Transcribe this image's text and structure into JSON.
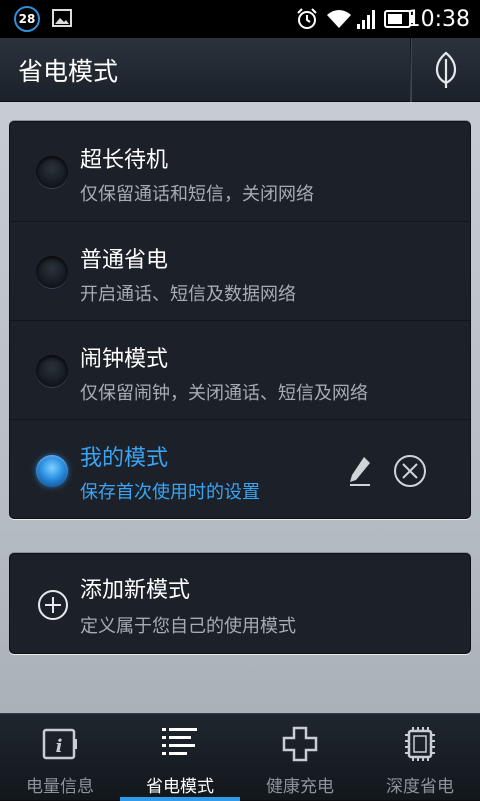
{
  "status_bar": {
    "notification_count": "28",
    "time": "10:38",
    "icons": [
      "gallery-icon",
      "alarm-icon",
      "wifi-icon",
      "signal-icon",
      "battery-icon"
    ]
  },
  "header": {
    "title": "省电模式",
    "action_icon": "leaf-icon"
  },
  "modes": [
    {
      "title": "超长待机",
      "desc": "仅保留通话和短信，关闭网络",
      "selected": false
    },
    {
      "title": "普通省电",
      "desc": "开启通话、短信及数据网络",
      "selected": false
    },
    {
      "title": "闹钟模式",
      "desc": "仅保留闹钟，关闭通话、短信及网络",
      "selected": false
    },
    {
      "title": "我的模式",
      "desc": "保存首次使用时的设置",
      "selected": true
    }
  ],
  "add_mode": {
    "title": "添加新模式",
    "desc": "定义属于您自己的使用模式"
  },
  "tabs": [
    {
      "label": "电量信息",
      "icon": "battery-info-icon",
      "active": false
    },
    {
      "label": "省电模式",
      "icon": "list-icon",
      "active": true
    },
    {
      "label": "健康充电",
      "icon": "plus-cross-icon",
      "active": false
    },
    {
      "label": "深度省电",
      "icon": "chip-icon",
      "active": false
    }
  ],
  "colors": {
    "accent": "#3aa3f2",
    "card_bg": "#1c2129",
    "content_bg": "#c0c6cd"
  }
}
